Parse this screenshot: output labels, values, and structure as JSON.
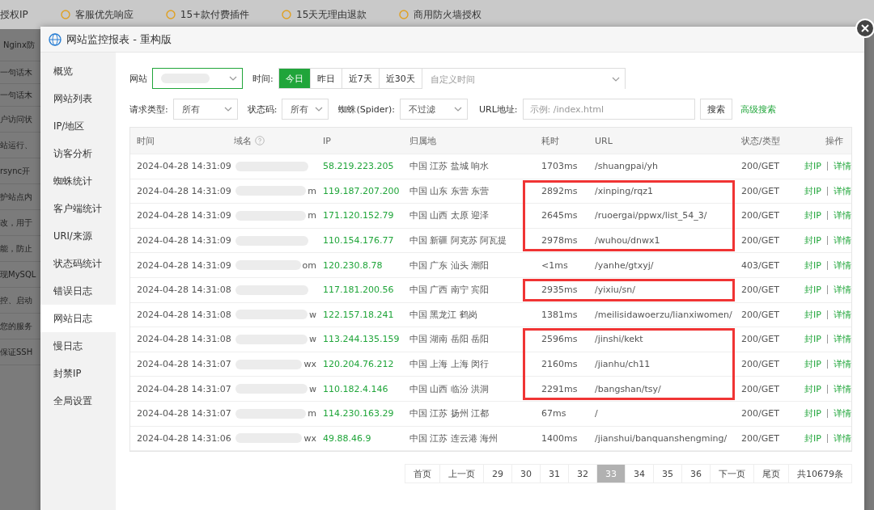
{
  "background": {
    "top_bar": [
      "授权IP",
      "客服优先响应",
      "15+款付费插件",
      "15天无理由退款",
      "商用防火墙授权"
    ],
    "side_texts": [
      "Nginx防",
      "一句话木",
      "一句话木",
      "户访问状",
      "站运行、",
      "rsync开",
      "护站点内",
      "改，用于",
      "能，防止",
      "现MySQL",
      "控、启动",
      "您的服务",
      "保证SSH"
    ]
  },
  "window": {
    "title": "网站监控报表 - 重构版"
  },
  "sidebar": {
    "items": [
      {
        "label": "概览",
        "selected": false
      },
      {
        "label": "网站列表",
        "selected": false
      },
      {
        "label": "IP/地区",
        "selected": false
      },
      {
        "label": "访客分析",
        "selected": false
      },
      {
        "label": "蜘蛛统计",
        "selected": false
      },
      {
        "label": "客户端统计",
        "selected": false
      },
      {
        "label": "URI/来源",
        "selected": false
      },
      {
        "label": "状态码统计",
        "selected": false
      },
      {
        "label": "错误日志",
        "selected": false
      },
      {
        "label": "网站日志",
        "selected": true
      },
      {
        "label": "慢日志",
        "selected": false
      },
      {
        "label": "封禁IP",
        "selected": false
      },
      {
        "label": "全局设置",
        "selected": false
      }
    ]
  },
  "filters": {
    "site_label": "网站",
    "time_label": "时间:",
    "time_tabs": [
      {
        "label": "今日",
        "selected": true
      },
      {
        "label": "昨日",
        "selected": false
      },
      {
        "label": "近7天",
        "selected": false
      },
      {
        "label": "近30天",
        "selected": false
      }
    ],
    "custom_time_placeholder": "自定义时间",
    "request_type_label": "请求类型:",
    "request_type": "所有",
    "status_label": "状态码:",
    "status": "所有",
    "spider_label": "蜘蛛(Spider):",
    "spider": "不过滤",
    "url_label": "URL地址:",
    "url_placeholder": "示例: /index.html",
    "search_button": "搜索",
    "advanced_link": "高级搜索"
  },
  "table": {
    "columns": [
      "时间",
      "域名",
      "IP",
      "归属地",
      "耗时",
      "URL",
      "状态/类型",
      "操作"
    ],
    "rows": [
      {
        "time": "2024-04-28 14:31:09",
        "ip": "58.219.223.205",
        "location": "中国 江苏 盐城 响水",
        "duration": "1703ms",
        "url": "/shuangpai/yh",
        "status": "200/GET",
        "actions": [
          "封IP",
          "详情"
        ],
        "highlighted": false
      },
      {
        "time": "2024-04-28 14:31:09",
        "domain": "m",
        "ip": "119.187.207.200",
        "location": "中国 山东 东营 东营",
        "duration": "2892ms",
        "url": "/xinping/rqz1",
        "status": "200/GET",
        "actions": [
          "封IP",
          "详情"
        ],
        "highlighted": true,
        "box_start": true,
        "box_end": false
      },
      {
        "time": "2024-04-28 14:31:09",
        "domain": "m",
        "ip": "171.120.152.79",
        "location": "中国 山西 太原 迎泽",
        "duration": "2645ms",
        "url": "/ruoergai/ppwx/list_54_3/",
        "status": "200/GET",
        "actions": [
          "封IP",
          "详情"
        ],
        "highlighted": true,
        "box_start": false,
        "box_end": false
      },
      {
        "time": "2024-04-28 14:31:09",
        "ip": "110.154.176.77",
        "location": "中国 新疆 阿克苏 阿瓦提",
        "duration": "2978ms",
        "url": "/wuhou/dnwx1",
        "status": "200/GET",
        "actions": [
          "封IP",
          "详情"
        ],
        "highlighted": true,
        "box_start": false,
        "box_end": true
      },
      {
        "time": "2024-04-28 14:31:09",
        "domain": "om",
        "ip": "120.230.8.78",
        "location": "中国 广东 汕头 潮阳",
        "duration": "<1ms",
        "url": "/yanhe/gtxyj/",
        "status": "403/GET",
        "actions": [
          "封IP",
          "详情"
        ],
        "highlighted": false
      },
      {
        "time": "2024-04-28 14:31:08",
        "ip": "117.181.200.56",
        "location": "中国 广西 南宁 宾阳",
        "duration": "2935ms",
        "url": "/yixiu/sn/",
        "status": "200/GET",
        "actions": [
          "封IP",
          "详情"
        ],
        "highlighted": true,
        "box_start": true,
        "box_end": true
      },
      {
        "time": "2024-04-28 14:31:08",
        "domain": "w",
        "ip": "122.157.18.241",
        "location": "中国 黑龙江 鹤岗",
        "duration": "1381ms",
        "url": "/meilisidawoerzu/lianxiwomen/",
        "status": "200/GET",
        "actions": [
          "封IP",
          "详情"
        ],
        "highlighted": false
      },
      {
        "time": "2024-04-28 14:31:08",
        "domain": "w",
        "ip": "113.244.135.159",
        "location": "中国 湖南 岳阳 岳阳",
        "duration": "2596ms",
        "url": "/jinshi/kekt",
        "status": "200/GET",
        "actions": [
          "封IP",
          "详情"
        ],
        "highlighted": true,
        "box_start": true,
        "box_end": false
      },
      {
        "time": "2024-04-28 14:31:07",
        "domain": "wx",
        "ip": "120.204.76.212",
        "location": "中国 上海 上海 闵行",
        "duration": "2160ms",
        "url": "/jianhu/ch11",
        "status": "200/GET",
        "actions": [
          "封IP",
          "详情"
        ],
        "highlighted": true,
        "box_start": false,
        "box_end": false
      },
      {
        "time": "2024-04-28 14:31:07",
        "domain": "w",
        "ip": "110.182.4.146",
        "location": "中国 山西 临汾 洪洞",
        "duration": "2291ms",
        "url": "/bangshan/tsy/",
        "status": "200/GET",
        "actions": [
          "封IP",
          "详情"
        ],
        "highlighted": true,
        "box_start": false,
        "box_end": true
      },
      {
        "time": "2024-04-28 14:31:07",
        "domain": "m",
        "ip": "114.230.163.29",
        "location": "中国 江苏 扬州 江都",
        "duration": "67ms",
        "url": "/",
        "status": "200/GET",
        "actions": [
          "封IP",
          "详情"
        ],
        "highlighted": false
      },
      {
        "time": "2024-04-28 14:31:06",
        "domain": "wx",
        "ip": "49.88.46.9",
        "location": "中国 江苏 连云港 海州",
        "duration": "1400ms",
        "url": "/jianshui/banquanshengming/",
        "status": "200/GET",
        "actions": [
          "封IP",
          "详情"
        ],
        "highlighted": false
      }
    ]
  },
  "pagination": {
    "items": [
      {
        "label": "首页",
        "selected": false
      },
      {
        "label": "上一页",
        "selected": false
      },
      {
        "label": "29",
        "selected": false
      },
      {
        "label": "30",
        "selected": false
      },
      {
        "label": "31",
        "selected": false
      },
      {
        "label": "32",
        "selected": false
      },
      {
        "label": "33",
        "selected": true
      },
      {
        "label": "34",
        "selected": false
      },
      {
        "label": "35",
        "selected": false
      },
      {
        "label": "36",
        "selected": false
      },
      {
        "label": "下一页",
        "selected": false
      },
      {
        "label": "尾页",
        "selected": false
      }
    ],
    "total": "共10679条"
  }
}
